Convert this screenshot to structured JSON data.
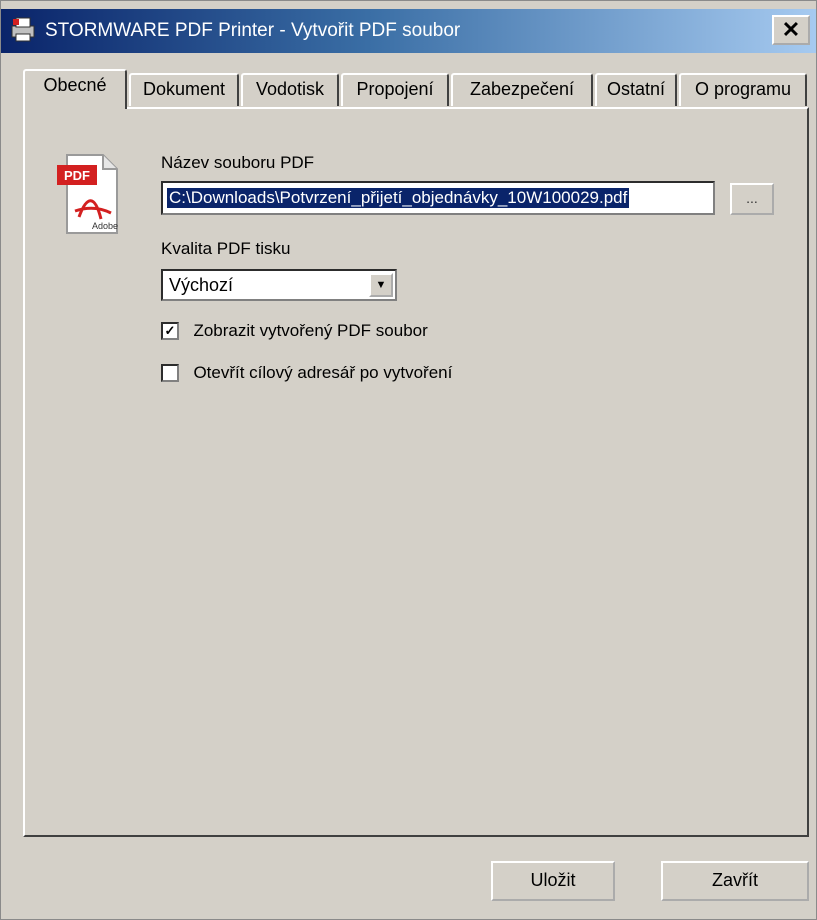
{
  "window": {
    "title": "STORMWARE PDF Printer - Vytvořit PDF soubor",
    "close_label": "✕"
  },
  "tabs": [
    {
      "label": "Obecné",
      "active": true
    },
    {
      "label": "Dokument",
      "active": false
    },
    {
      "label": "Vodotisk",
      "active": false
    },
    {
      "label": "Propojení",
      "active": false
    },
    {
      "label": "Zabezpečení",
      "active": false
    },
    {
      "label": "Ostatní",
      "active": false
    },
    {
      "label": "O programu",
      "active": false
    }
  ],
  "general": {
    "file_label": "Název souboru PDF",
    "file_value": "C:\\Downloads\\Potvrzení_přijetí_objednávky_10W100029.pdf",
    "browse_label": "...",
    "quality_label": "Kvalita PDF tisku",
    "quality_value": "Výchozí",
    "show_pdf": {
      "label": "Zobrazit vytvořený PDF soubor",
      "checked": true
    },
    "open_folder": {
      "label": "Otevřít cílový adresář po vytvoření",
      "checked": false
    },
    "pdf_icon": {
      "badge": "PDF",
      "brand": "Adobe",
      "name": "pdf-file-icon"
    }
  },
  "buttons": {
    "save": "Uložit",
    "close": "Zavřít"
  },
  "colors": {
    "selection": "#0a246a",
    "pdf_red": "#d32020",
    "dialog_bg": "#d4d0c8"
  }
}
